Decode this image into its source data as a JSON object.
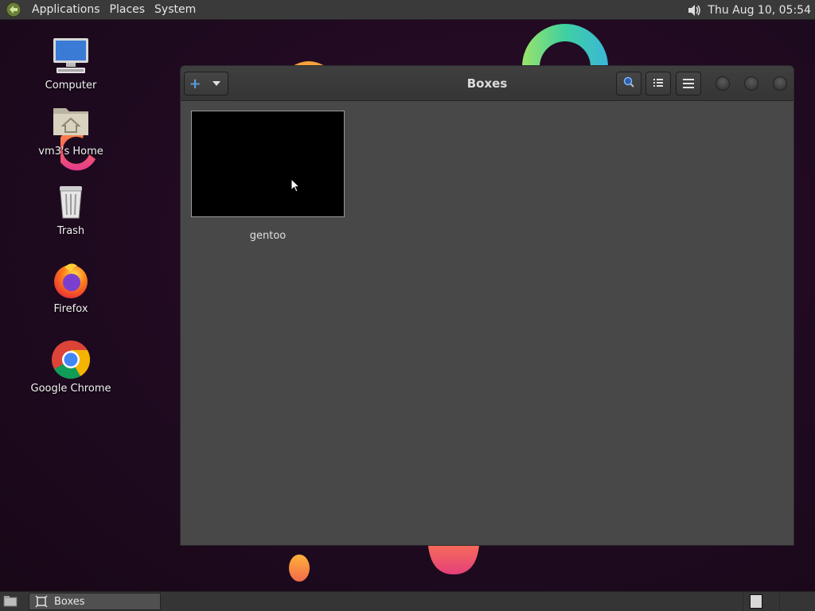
{
  "top_panel": {
    "menus": [
      "Applications",
      "Places",
      "System"
    ],
    "clock": "Thu Aug 10, 05:54",
    "icons": [
      "mate-logo-icon",
      "volume-icon"
    ]
  },
  "desktop": {
    "icons": [
      {
        "label": "Computer",
        "icon": "computer-icon"
      },
      {
        "label": "vm3's Home",
        "icon": "home-folder-icon"
      },
      {
        "label": "Trash",
        "icon": "trash-icon"
      },
      {
        "label": "Firefox",
        "icon": "firefox-icon"
      },
      {
        "label": "Google Chrome",
        "icon": "chrome-icon"
      }
    ]
  },
  "window": {
    "title": "Boxes",
    "header_buttons": [
      "new-box-icon",
      "dropdown-caret-icon",
      "search-icon",
      "selection-list-icon",
      "menu-icon"
    ],
    "boxes": [
      {
        "name": "gentoo"
      }
    ]
  },
  "bottom_panel": {
    "tasks": [
      {
        "label": "Boxes",
        "icon": "boxes-app-icon"
      }
    ]
  },
  "colors": {
    "desktop_bg": "#1f0a20",
    "panel_bg": "#3a3a3a",
    "window_bg": "#484848",
    "accent": "#5b9bd5"
  }
}
